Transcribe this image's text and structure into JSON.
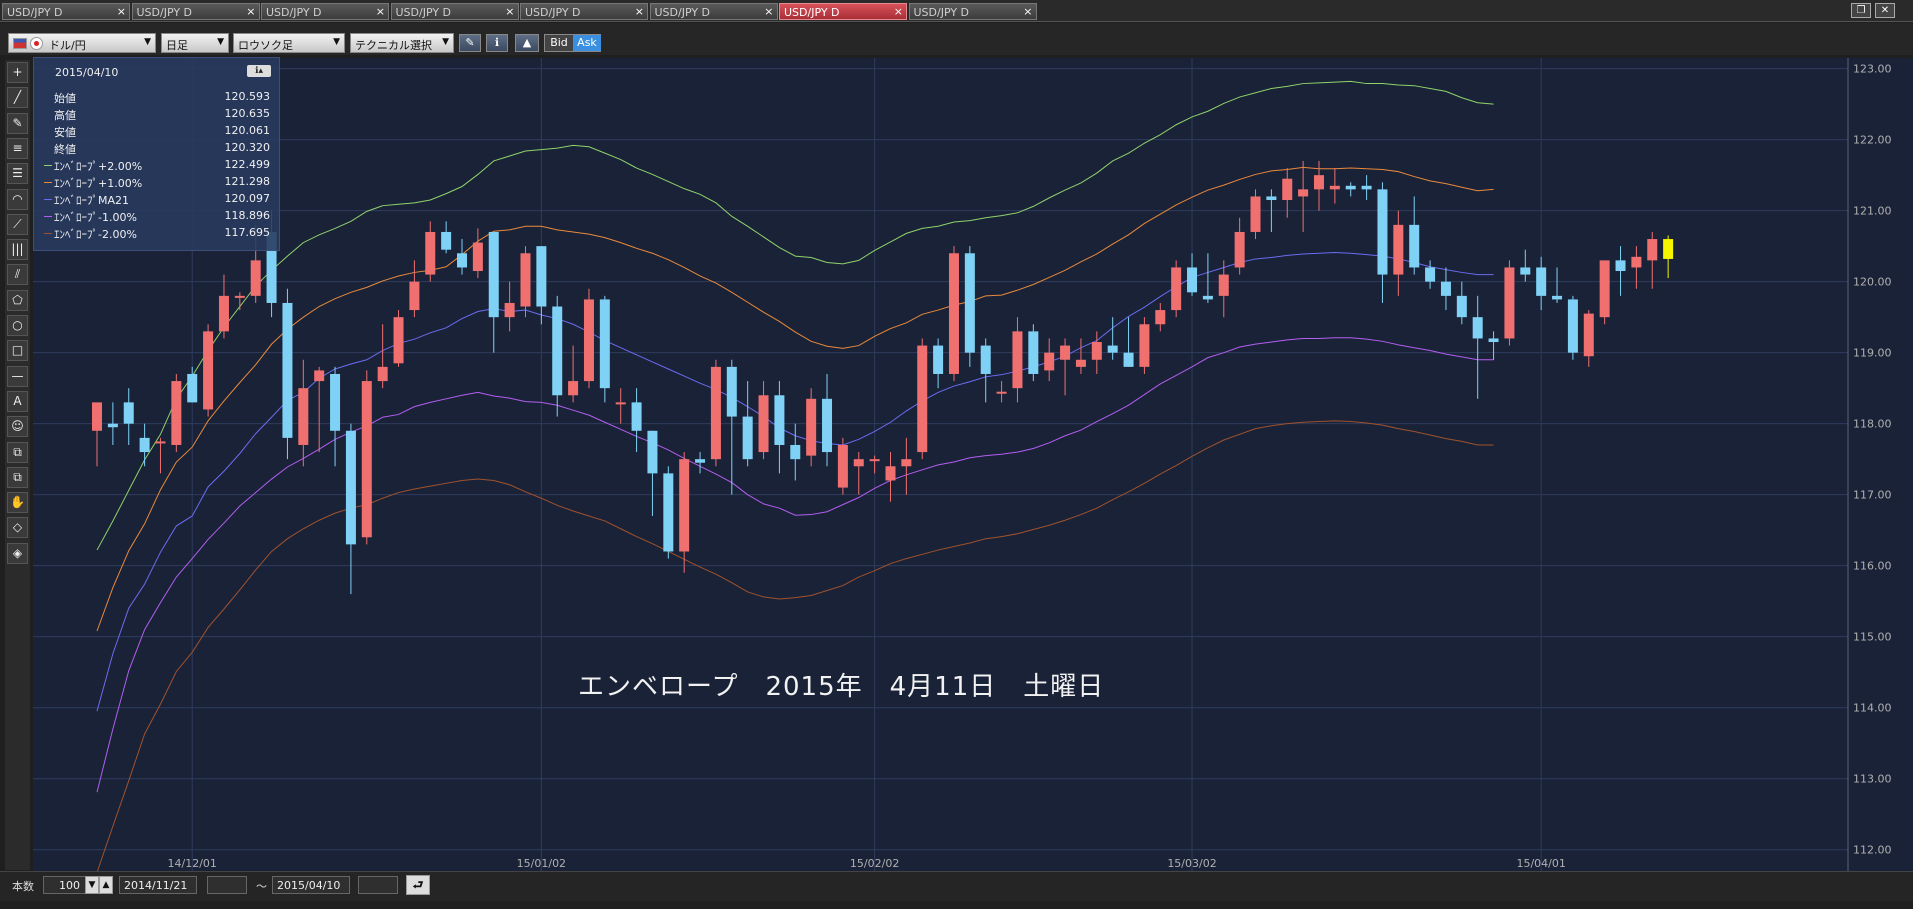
{
  "tabs": [
    {
      "label": "USD/JPY D",
      "active": false
    },
    {
      "label": "USD/JPY D",
      "active": false
    },
    {
      "label": "USD/JPY D",
      "active": false
    },
    {
      "label": "USD/JPY D",
      "active": false
    },
    {
      "label": "USD/JPY D",
      "active": false
    },
    {
      "label": "USD/JPY D",
      "active": false
    },
    {
      "label": "USD/JPY D",
      "active": true
    },
    {
      "label": "USD/JPY D",
      "active": false
    }
  ],
  "tab_close": "×",
  "window_controls": [
    "restore-icon",
    "close-icon"
  ],
  "toolbar": {
    "symbol": "ドル/円",
    "period": "日足",
    "chart_type": "ロウソク足",
    "technical": "テクニカル選択",
    "bid": "Bid",
    "ask": "Ask"
  },
  "tools": [
    "crosshair-icon",
    "line-icon",
    "pencil-icon",
    "horizontal-lines-icon",
    "lines-icon",
    "arc-icon",
    "fan-icon",
    "vertical-lines-icon",
    "channel-icon",
    "pentagon-icon",
    "circle-icon",
    "rectangle-icon",
    "horizontal-line-icon",
    "text-icon",
    "smile-icon",
    "copy-icon",
    "paste-icon",
    "hand-icon",
    "eraser-icon",
    "eraser-all-icon"
  ],
  "tool_glyphs": [
    "+",
    "╱",
    "✎",
    "≡",
    "☰",
    "◠",
    "⟋",
    "|||",
    "⫽",
    "⬠",
    "○",
    "□",
    "—",
    "A",
    "☺",
    "⧉",
    "⧉",
    "✋",
    "◇",
    "◈"
  ],
  "info_panel": {
    "date": "2015/04/10",
    "rows": [
      {
        "label": "始値",
        "value": "120.593",
        "color": ""
      },
      {
        "label": "高値",
        "value": "120.635",
        "color": ""
      },
      {
        "label": "安値",
        "value": "120.061",
        "color": ""
      },
      {
        "label": "終値",
        "value": "120.320",
        "color": ""
      },
      {
        "label": "ｴﾝﾍﾞﾛｰﾌﾟ+2.00%",
        "value": "122.499",
        "color": "#8fd36b"
      },
      {
        "label": "ｴﾝﾍﾞﾛｰﾌﾟ+1.00%",
        "value": "121.298",
        "color": "#e98a3a"
      },
      {
        "label": "ｴﾝﾍﾞﾛｰﾌﾟMA21",
        "value": "120.097",
        "color": "#6a6cf0"
      },
      {
        "label": "ｴﾝﾍﾞﾛｰﾌﾟ-1.00%",
        "value": "118.896",
        "color": "#b35ef0"
      },
      {
        "label": "ｴﾝﾍﾞﾛｰﾌﾟ-2.00%",
        "value": "117.695",
        "color": "#a0522d"
      }
    ]
  },
  "watermark": "エンベロープ　2015年　4月11日　土曜日",
  "bottom": {
    "count_label": "本数",
    "count_value": "100",
    "from_date": "2014/11/21",
    "tilde": "～",
    "to_date": "2015/04/10",
    "apply": "⮐"
  },
  "chart_data": {
    "type": "candlestick",
    "ylim": [
      111.7,
      123.15
    ],
    "yticks": [
      "123.00",
      "122.00",
      "121.00",
      "120.00",
      "119.00",
      "118.00",
      "117.00",
      "116.00",
      "115.00",
      "114.00",
      "113.00",
      "112.00"
    ],
    "xticks": [
      {
        "label": "14/12/01",
        "index": 6
      },
      {
        "label": "15/01/02",
        "index": 28
      },
      {
        "label": "15/02/02",
        "index": 49
      },
      {
        "label": "15/03/02",
        "index": 69
      },
      {
        "label": "15/04/01",
        "index": 91
      }
    ],
    "colors": {
      "up": "#f07070",
      "down": "#7fd2f5",
      "last": "#f5f500",
      "bg": "#1a2238",
      "grid": "#2e3c5c"
    },
    "candles": [
      [
        117.9,
        118.2,
        117.4,
        118.3
      ],
      [
        118.0,
        118.3,
        117.7,
        117.95
      ],
      [
        118.3,
        118.5,
        117.7,
        118.0
      ],
      [
        117.8,
        118.0,
        117.4,
        117.6
      ],
      [
        117.75,
        117.8,
        117.3,
        117.75
      ],
      [
        117.7,
        118.7,
        117.6,
        118.6
      ],
      [
        118.7,
        118.8,
        118.3,
        118.3
      ],
      [
        118.2,
        119.4,
        118.1,
        119.3
      ],
      [
        119.3,
        120.1,
        119.2,
        119.8
      ],
      [
        119.8,
        119.85,
        119.6,
        119.8
      ],
      [
        119.8,
        120.8,
        119.7,
        120.3
      ],
      [
        120.7,
        121.0,
        119.5,
        119.7
      ],
      [
        119.7,
        119.9,
        117.5,
        117.8
      ],
      [
        117.7,
        118.9,
        117.4,
        118.5
      ],
      [
        118.6,
        118.8,
        117.6,
        118.75
      ],
      [
        118.7,
        118.8,
        117.4,
        117.9
      ],
      [
        117.9,
        118.0,
        115.6,
        116.3
      ],
      [
        116.4,
        118.75,
        116.3,
        118.6
      ],
      [
        118.6,
        119.4,
        118.5,
        118.8
      ],
      [
        118.85,
        119.6,
        118.8,
        119.5
      ],
      [
        119.6,
        120.3,
        119.5,
        120.0
      ],
      [
        120.1,
        120.85,
        120.0,
        120.7
      ],
      [
        120.7,
        120.85,
        120.4,
        120.45
      ],
      [
        120.4,
        120.6,
        120.1,
        120.2
      ],
      [
        120.15,
        120.75,
        120.05,
        120.55
      ],
      [
        120.7,
        120.7,
        119.0,
        119.5
      ],
      [
        119.5,
        120.0,
        119.3,
        119.7
      ],
      [
        119.65,
        120.5,
        119.5,
        120.4
      ],
      [
        120.5,
        120.5,
        119.4,
        119.65
      ],
      [
        119.65,
        119.8,
        118.1,
        118.4
      ],
      [
        118.4,
        119.1,
        118.3,
        118.6
      ],
      [
        118.6,
        119.9,
        118.5,
        119.75
      ],
      [
        119.75,
        119.8,
        118.3,
        118.5
      ],
      [
        118.3,
        118.5,
        118.0,
        118.3
      ],
      [
        118.3,
        118.5,
        117.6,
        117.9
      ],
      [
        117.9,
        117.9,
        116.7,
        117.3
      ],
      [
        117.3,
        117.4,
        116.1,
        116.2
      ],
      [
        116.2,
        117.6,
        115.9,
        117.5
      ],
      [
        117.5,
        117.6,
        117.3,
        117.45
      ],
      [
        117.5,
        118.9,
        117.4,
        118.8
      ],
      [
        118.8,
        118.9,
        117.0,
        118.1
      ],
      [
        118.1,
        118.6,
        117.4,
        117.5
      ],
      [
        117.6,
        118.6,
        117.5,
        118.4
      ],
      [
        118.4,
        118.6,
        117.3,
        117.7
      ],
      [
        117.7,
        118.0,
        117.2,
        117.5
      ],
      [
        117.55,
        118.5,
        117.4,
        118.35
      ],
      [
        118.35,
        118.7,
        117.4,
        117.6
      ],
      [
        117.1,
        117.8,
        117.0,
        117.7
      ],
      [
        117.4,
        117.6,
        117.0,
        117.5
      ],
      [
        117.5,
        117.55,
        117.3,
        117.5
      ],
      [
        117.2,
        117.6,
        116.9,
        117.4
      ],
      [
        117.4,
        117.8,
        117.0,
        117.5
      ],
      [
        117.6,
        119.2,
        117.5,
        119.1
      ],
      [
        119.1,
        119.2,
        118.5,
        118.7
      ],
      [
        118.7,
        120.5,
        118.6,
        120.4
      ],
      [
        120.4,
        120.5,
        118.8,
        119.0
      ],
      [
        119.1,
        119.2,
        118.3,
        118.7
      ],
      [
        118.45,
        118.6,
        118.3,
        118.45
      ],
      [
        118.5,
        119.5,
        118.3,
        119.3
      ],
      [
        119.3,
        119.4,
        118.6,
        118.7
      ],
      [
        118.75,
        119.2,
        118.6,
        119.0
      ],
      [
        118.9,
        119.2,
        118.4,
        119.1
      ],
      [
        118.8,
        119.2,
        118.7,
        118.9
      ],
      [
        118.9,
        119.3,
        118.7,
        119.15
      ],
      [
        119.1,
        119.5,
        118.9,
        119.0
      ],
      [
        119.0,
        119.5,
        118.8,
        118.8
      ],
      [
        118.8,
        119.5,
        118.7,
        119.4
      ],
      [
        119.4,
        119.7,
        119.3,
        119.6
      ],
      [
        119.6,
        120.3,
        119.5,
        120.2
      ],
      [
        120.2,
        120.4,
        119.8,
        119.85
      ],
      [
        119.8,
        120.4,
        119.7,
        119.75
      ],
      [
        119.8,
        120.3,
        119.5,
        120.1
      ],
      [
        120.2,
        120.9,
        120.1,
        120.7
      ],
      [
        120.7,
        121.3,
        120.6,
        121.2
      ],
      [
        121.2,
        121.3,
        120.7,
        121.15
      ],
      [
        121.15,
        121.6,
        120.9,
        121.45
      ],
      [
        121.2,
        121.7,
        120.7,
        121.3
      ],
      [
        121.3,
        121.7,
        121.0,
        121.5
      ],
      [
        121.3,
        121.6,
        121.1,
        121.35
      ],
      [
        121.35,
        121.4,
        121.2,
        121.3
      ],
      [
        121.35,
        121.5,
        121.15,
        121.3
      ],
      [
        121.3,
        121.4,
        119.7,
        120.1
      ],
      [
        120.1,
        121.0,
        119.8,
        120.8
      ],
      [
        120.8,
        121.2,
        120.1,
        120.2
      ],
      [
        120.2,
        120.3,
        119.9,
        120.0
      ],
      [
        120.0,
        120.2,
        119.6,
        119.8
      ],
      [
        119.8,
        120.0,
        119.4,
        119.5
      ],
      [
        119.5,
        119.8,
        118.35,
        119.2
      ],
      [
        119.2,
        119.3,
        118.9,
        119.15
      ],
      [
        119.2,
        120.3,
        119.1,
        120.2
      ],
      [
        120.2,
        120.45,
        120.0,
        120.1
      ],
      [
        120.2,
        120.35,
        119.6,
        119.8
      ],
      [
        119.8,
        120.2,
        119.7,
        119.75
      ],
      [
        119.75,
        119.8,
        118.9,
        119.0
      ],
      [
        118.95,
        119.6,
        118.8,
        119.55
      ],
      [
        119.5,
        120.3,
        119.4,
        120.3
      ],
      [
        120.3,
        120.5,
        119.8,
        120.15
      ],
      [
        120.2,
        120.5,
        119.9,
        120.35
      ],
      [
        120.3,
        120.7,
        119.9,
        120.6
      ],
      [
        120.6,
        120.65,
        120.05,
        120.32
      ]
    ],
    "series": [
      {
        "name": "ｴﾝﾍﾞﾛｰﾌﾟ+2.00%",
        "color": "#8fd36b",
        "values": [
          116.22,
          116.63,
          117.06,
          117.49,
          117.85,
          118.35,
          118.67,
          119.03,
          119.36,
          119.65,
          119.94,
          120.16,
          120.36,
          120.55,
          120.66,
          120.75,
          120.85,
          120.99,
          121.07,
          121.09,
          121.11,
          121.15,
          121.24,
          121.34,
          121.51,
          121.7,
          121.77,
          121.84,
          121.86,
          121.88,
          121.92,
          121.9,
          121.81,
          121.72,
          121.6,
          121.51,
          121.41,
          121.31,
          121.23,
          121.11,
          120.92,
          120.78,
          120.63,
          120.48,
          120.36,
          120.34,
          120.27,
          120.25,
          120.3,
          120.44,
          120.56,
          120.68,
          120.75,
          120.78,
          120.84,
          120.86,
          120.9,
          120.93,
          120.97,
          121.06,
          121.18,
          121.29,
          121.39,
          121.53,
          121.7,
          121.81,
          121.95,
          122.07,
          122.21,
          122.32,
          122.4,
          122.51,
          122.6,
          122.66,
          122.72,
          122.75,
          122.79,
          122.8,
          122.81,
          122.82,
          122.79,
          122.79,
          122.77,
          122.76,
          122.72,
          122.68,
          122.59,
          122.52,
          122.5
        ]
      },
      {
        "name": "ｴﾝﾍﾞﾛｰﾌﾟ+1.00%",
        "color": "#e98a3a",
        "values": [
          115.08,
          115.69,
          116.21,
          116.59,
          117.07,
          117.46,
          117.67,
          118.04,
          118.32,
          118.58,
          118.83,
          119.12,
          119.33,
          119.5,
          119.65,
          119.76,
          119.85,
          119.92,
          120.01,
          120.08,
          120.13,
          120.16,
          120.21,
          120.38,
          120.57,
          120.71,
          120.73,
          120.78,
          120.78,
          120.73,
          120.7,
          120.67,
          120.62,
          120.55,
          120.47,
          120.4,
          120.31,
          120.2,
          120.08,
          119.98,
          119.85,
          119.71,
          119.57,
          119.44,
          119.29,
          119.16,
          119.09,
          119.06,
          119.1,
          119.23,
          119.34,
          119.42,
          119.54,
          119.6,
          119.67,
          119.72,
          119.8,
          119.81,
          119.88,
          119.96,
          120.06,
          120.16,
          120.28,
          120.39,
          120.53,
          120.66,
          120.82,
          120.95,
          121.08,
          121.19,
          121.29,
          121.36,
          121.44,
          121.51,
          121.56,
          121.58,
          121.61,
          121.59,
          121.59,
          121.6,
          121.59,
          121.58,
          121.55,
          121.48,
          121.42,
          121.38,
          121.33,
          121.28,
          121.3
        ]
      },
      {
        "name": "ｴﾝﾍﾞﾛｰﾌﾟMA21",
        "color": "#6a6cf0",
        "values": [
          113.95,
          114.76,
          115.4,
          115.74,
          116.19,
          116.56,
          116.7,
          117.11,
          117.33,
          117.58,
          117.86,
          118.09,
          118.33,
          118.44,
          118.64,
          118.77,
          118.84,
          118.9,
          119.03,
          119.13,
          119.19,
          119.28,
          119.35,
          119.48,
          119.58,
          119.62,
          119.58,
          119.6,
          119.53,
          119.48,
          119.4,
          119.29,
          119.17,
          119.07,
          118.97,
          118.87,
          118.77,
          118.67,
          118.57,
          118.48,
          118.37,
          118.24,
          118.1,
          117.94,
          117.83,
          117.76,
          117.72,
          117.7,
          117.78,
          117.89,
          118.02,
          118.18,
          118.32,
          118.44,
          118.53,
          118.59,
          118.66,
          118.69,
          118.74,
          118.8,
          118.87,
          118.95,
          119.07,
          119.17,
          119.35,
          119.51,
          119.64,
          119.79,
          119.93,
          120.06,
          120.13,
          120.2,
          120.27,
          120.32,
          120.34,
          120.37,
          120.39,
          120.4,
          120.41,
          120.4,
          120.38,
          120.36,
          120.32,
          120.27,
          120.21,
          120.17,
          120.13,
          120.1,
          120.1
        ]
      },
      {
        "name": "ｴﾝﾍﾞﾛｰﾌﾟ-1.00%",
        "color": "#b35ef0",
        "values": [
          112.81,
          113.7,
          114.52,
          115.1,
          115.48,
          115.84,
          116.1,
          116.37,
          116.6,
          116.84,
          117.03,
          117.22,
          117.39,
          117.51,
          117.64,
          117.78,
          117.88,
          117.97,
          118.09,
          118.13,
          118.24,
          118.3,
          118.35,
          118.4,
          118.44,
          118.39,
          118.36,
          118.31,
          118.3,
          118.26,
          118.19,
          118.12,
          118.02,
          117.92,
          117.82,
          117.73,
          117.63,
          117.51,
          117.4,
          117.29,
          117.17,
          117.0,
          116.87,
          116.81,
          116.71,
          116.72,
          116.76,
          116.86,
          116.96,
          117.09,
          117.2,
          117.28,
          117.35,
          117.42,
          117.46,
          117.52,
          117.55,
          117.57,
          117.6,
          117.65,
          117.73,
          117.83,
          117.91,
          118.03,
          118.14,
          118.26,
          118.41,
          118.56,
          118.68,
          118.8,
          118.93,
          119.0,
          119.08,
          119.12,
          119.15,
          119.18,
          119.2,
          119.2,
          119.21,
          119.21,
          119.19,
          119.16,
          119.11,
          119.07,
          119.03,
          118.98,
          118.94,
          118.9,
          118.9
        ]
      },
      {
        "name": "ｴﾝﾍﾞﾛｰﾌﾟ-2.00%",
        "color": "#a0522d",
        "values": [
          111.68,
          112.33,
          112.97,
          113.63,
          114.05,
          114.51,
          114.78,
          115.13,
          115.39,
          115.66,
          115.94,
          116.2,
          116.38,
          116.52,
          116.64,
          116.74,
          116.81,
          116.86,
          116.95,
          117.03,
          117.08,
          117.12,
          117.16,
          117.2,
          117.22,
          117.2,
          117.14,
          117.04,
          116.95,
          116.85,
          116.77,
          116.7,
          116.63,
          116.52,
          116.41,
          116.31,
          116.2,
          116.09,
          115.98,
          115.88,
          115.76,
          115.63,
          115.56,
          115.53,
          115.55,
          115.58,
          115.65,
          115.72,
          115.84,
          115.93,
          116.03,
          116.1,
          116.16,
          116.22,
          116.27,
          116.32,
          116.38,
          116.41,
          116.45,
          116.51,
          116.57,
          116.64,
          116.72,
          116.81,
          116.93,
          117.04,
          117.16,
          117.29,
          117.41,
          117.54,
          117.66,
          117.77,
          117.85,
          117.93,
          117.97,
          118.0,
          118.02,
          118.03,
          118.04,
          118.03,
          118.01,
          117.98,
          117.93,
          117.89,
          117.84,
          117.79,
          117.75,
          117.7,
          117.7
        ]
      }
    ]
  }
}
